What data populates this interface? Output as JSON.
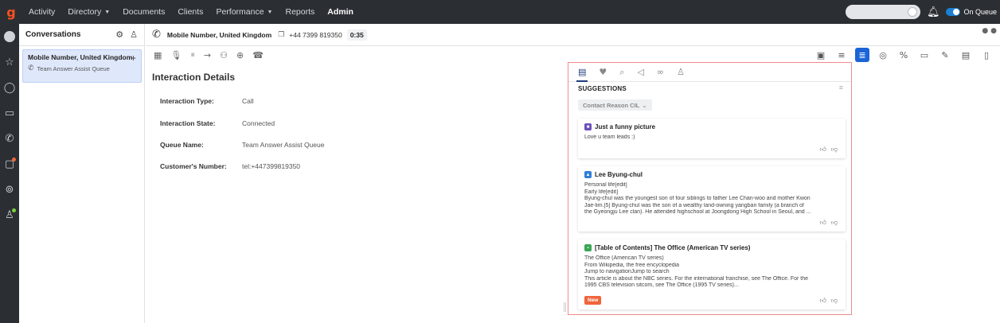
{
  "nav": {
    "items": [
      {
        "label": "Activity",
        "caret": false,
        "active": false
      },
      {
        "label": "Directory",
        "caret": true,
        "active": false
      },
      {
        "label": "Documents",
        "caret": false,
        "active": false
      },
      {
        "label": "Clients",
        "caret": false,
        "active": false
      },
      {
        "label": "Performance",
        "caret": true,
        "active": false
      },
      {
        "label": "Reports",
        "caret": false,
        "active": false
      },
      {
        "label": "Admin",
        "caret": false,
        "active": true
      }
    ],
    "logo": "g",
    "queue_status": "On Queue"
  },
  "conversations": {
    "title": "Conversations",
    "card": {
      "title": "Mobile Number, United Kingdom",
      "subtitle": "Team Answer Assist Queue"
    }
  },
  "call": {
    "title": "Mobile Number, United Kingdom",
    "number": "+44 7399 819350",
    "timer": "0:35"
  },
  "details": {
    "title": "Interaction Details",
    "rows": [
      {
        "label": "Interaction Type:",
        "value": "Call"
      },
      {
        "label": "Interaction State:",
        "value": "Connected"
      },
      {
        "label": "Queue Name:",
        "value": "Team Answer Assist Queue"
      },
      {
        "label": "Customer's Number:",
        "value": "tel:+447399819350"
      }
    ]
  },
  "assist": {
    "suggestions_label": "SUGGESTIONS",
    "reason_pill": "Contact Reason CIL",
    "cards": [
      {
        "title": "Just a funny picture",
        "badge_color": "#6b4fbb",
        "lines": [
          "Love u team leads :)"
        ],
        "is_new": false
      },
      {
        "title": "Lee Byung-chul",
        "badge_color": "#2f7fd6",
        "lines": [
          "Personal life[edit]",
          "Early life[edit]",
          "Byung-chul was the youngest son of four siblings to father Lee Chan-woo and mother Kwon",
          "Jae-lim.[5] Byung-chul was the son of a wealthy land-owning yangban family (a branch of",
          "the Gyeongju Lee clan). He attended highschool at Joongdong High School in Seoul, and ..."
        ],
        "is_new": false
      },
      {
        "title": "[Table of Contents] The Office (American TV series)",
        "badge_color": "#3aa757",
        "lines": [
          "The Office (American TV series)",
          "From Wikipedia, the free encyclopedia",
          "Jump to navigationJump to search",
          "This article is about the NBC series. For the international franchise, see The Office. For the",
          "1995 CBS television sitcom, see The Office (1995 TV series)..."
        ],
        "is_new": true,
        "new_label": "New"
      }
    ]
  },
  "colors": {
    "topbar": "#2b2f33",
    "accent": "#1b64d8",
    "logo": "#ff4f1f",
    "assist_border": "#ef8c8c",
    "new_badge": "#f0643b"
  }
}
